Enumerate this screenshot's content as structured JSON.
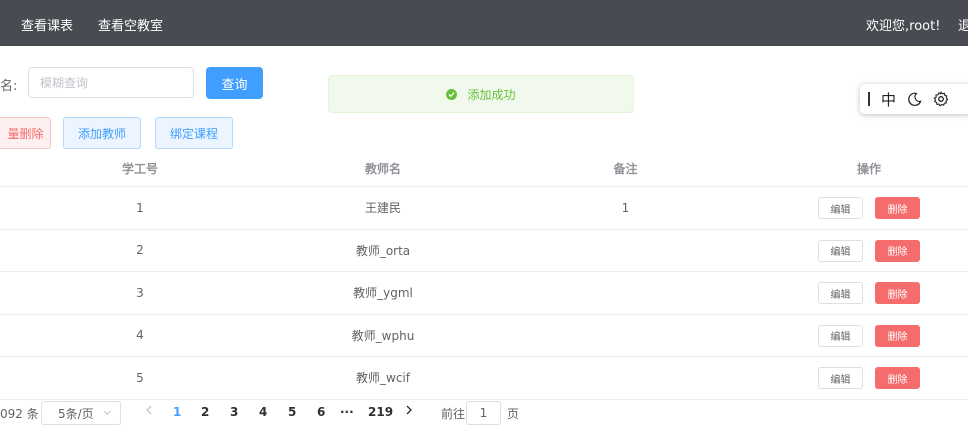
{
  "nav": {
    "items": [
      "查看课表",
      "查看空教室"
    ],
    "welcome": "欢迎您,root!",
    "logout_partial": "退"
  },
  "search": {
    "label_partial": "名:",
    "placeholder": "模糊查询",
    "button": "查询"
  },
  "toast": {
    "message": "添加成功",
    "type": "success",
    "color": "#67c23a"
  },
  "ime_toolbar": {
    "items": [
      "|",
      "中",
      "moon-icon",
      "gear-icon"
    ],
    "mode_label": "中"
  },
  "actions": {
    "batch_delete": "量删除",
    "add_teacher": "添加教师",
    "bind_course": "绑定课程"
  },
  "table": {
    "columns": [
      "学工号",
      "教师名",
      "备注",
      "操作"
    ],
    "rows": [
      {
        "id": "1",
        "name": "王建民",
        "note": "1"
      },
      {
        "id": "2",
        "name": "教师_orta",
        "note": ""
      },
      {
        "id": "3",
        "name": "教师_ygml",
        "note": ""
      },
      {
        "id": "4",
        "name": "教师_wphu",
        "note": ""
      },
      {
        "id": "5",
        "name": "教师_wcif",
        "note": ""
      }
    ],
    "edit_label": "编辑",
    "delete_label": "删除"
  },
  "pagination": {
    "total_partial": "092 条",
    "page_size": "5条/页",
    "pages": [
      "1",
      "2",
      "3",
      "4",
      "5",
      "6",
      "···",
      "219"
    ],
    "current_page": "1",
    "goto_label": "前往",
    "goto_value": "1",
    "page_suffix": "页"
  },
  "colors": {
    "primary": "#409eff",
    "danger": "#f56c6c",
    "success": "#67c23a",
    "topbar": "#484c52"
  }
}
